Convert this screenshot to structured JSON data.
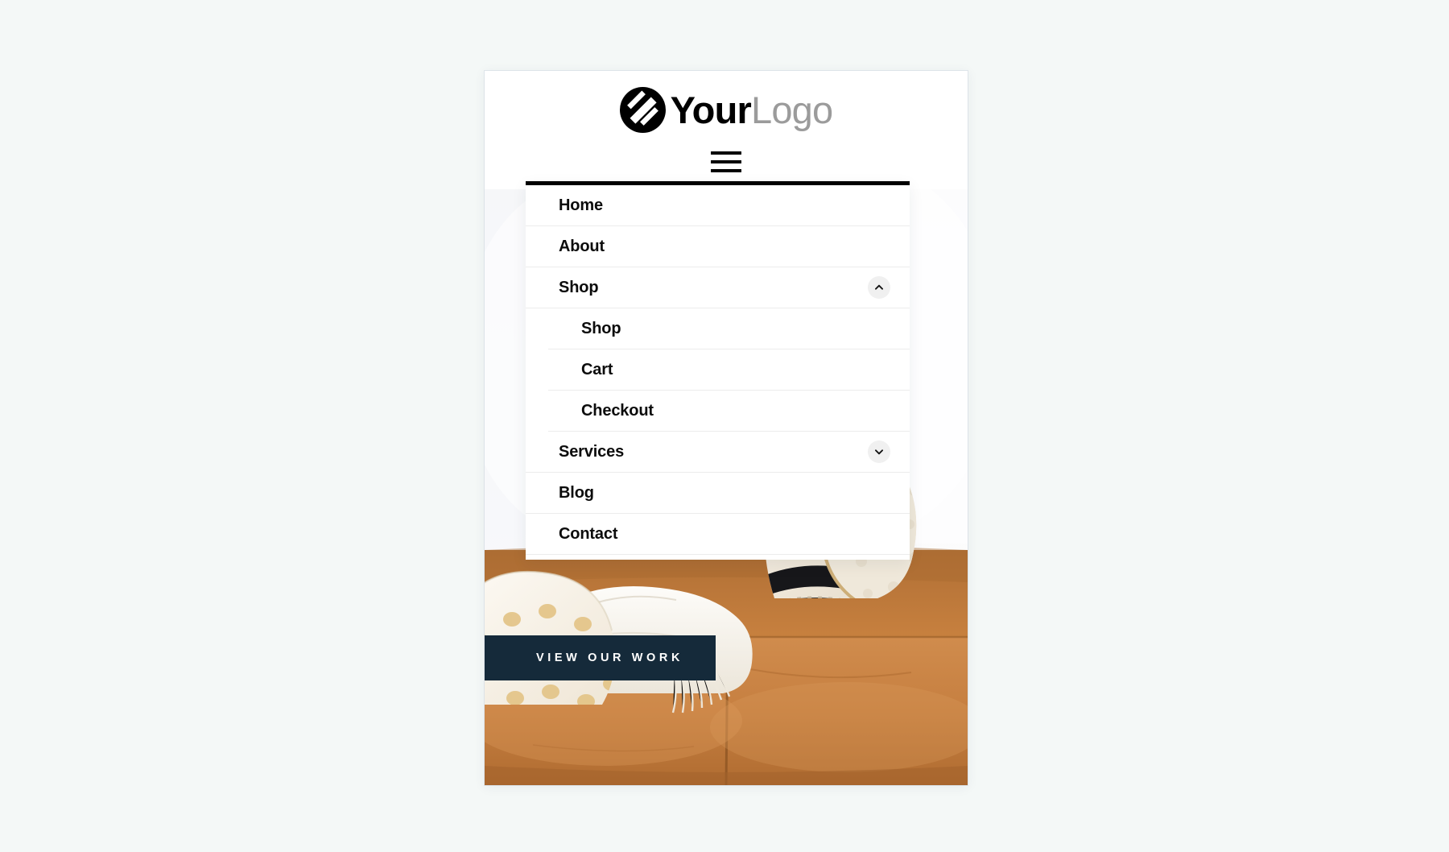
{
  "page": {
    "background_color": "#f4f8f7"
  },
  "header": {
    "logo": {
      "mark_name": "circular-s-monogram",
      "primary_text": "Your",
      "secondary_text": "Logo",
      "primary_color": "#000000",
      "secondary_color": "#9b9b9b"
    },
    "menu_toggle": {
      "icon": "hamburger-icon",
      "label": "Menu"
    }
  },
  "mobile_menu": {
    "open": true,
    "border_top_color": "#000000",
    "items": [
      {
        "label": "Home",
        "level": 1,
        "has_toggle": false,
        "toggle_icon": "",
        "expanded": false
      },
      {
        "label": "About",
        "level": 1,
        "has_toggle": false,
        "toggle_icon": "",
        "expanded": false
      },
      {
        "label": "Shop",
        "level": 1,
        "has_toggle": true,
        "toggle_icon": "chevron-up-icon",
        "expanded": true
      },
      {
        "label": "Shop",
        "level": 2,
        "has_toggle": false,
        "toggle_icon": "",
        "expanded": false
      },
      {
        "label": "Cart",
        "level": 2,
        "has_toggle": false,
        "toggle_icon": "",
        "expanded": false
      },
      {
        "label": "Checkout",
        "level": 2,
        "has_toggle": false,
        "toggle_icon": "",
        "expanded": false
      },
      {
        "label": "Services",
        "level": 1,
        "has_toggle": true,
        "toggle_icon": "chevron-down-icon",
        "expanded": false
      },
      {
        "label": "Blog",
        "level": 1,
        "has_toggle": false,
        "toggle_icon": "",
        "expanded": false
      },
      {
        "label": "Contact",
        "level": 1,
        "has_toggle": false,
        "toggle_icon": "",
        "expanded": false
      }
    ]
  },
  "hero": {
    "image_description": "tan leather sofa with cream polka-dot pillow and black-and-cream striped pillow",
    "cta": {
      "label": "VIEW OUR WORK",
      "background_color": "#152a3a",
      "text_color": "#ffffff"
    }
  }
}
